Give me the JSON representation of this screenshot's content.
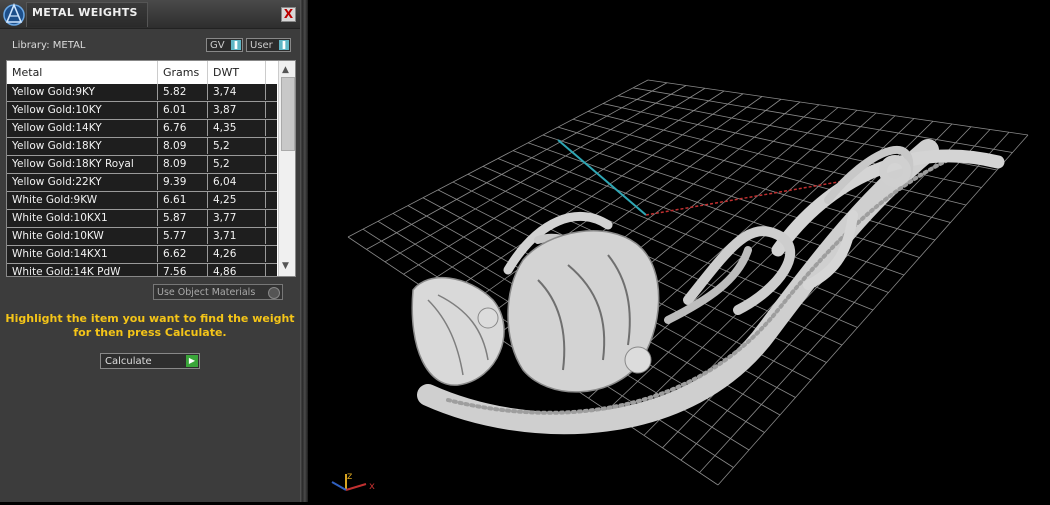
{
  "panel": {
    "title": "METAL WEIGHTS",
    "close_label": "X",
    "library_label": "Library: METAL",
    "gv_label": "GV",
    "user_label": "User",
    "use_object_materials": "Use Object Materials",
    "instruction_line1": "Highlight the item you want to find the weight",
    "instruction_line2": "for then press Calculate.",
    "calculate_label": "Calculate"
  },
  "table": {
    "columns": [
      "Metal",
      "Grams",
      "DWT"
    ],
    "rows": [
      {
        "metal": "Yellow Gold:9KY",
        "grams": "5.82",
        "dwt": "3,74"
      },
      {
        "metal": "Yellow Gold:10KY",
        "grams": "6.01",
        "dwt": "3,87"
      },
      {
        "metal": "Yellow Gold:14KY",
        "grams": "6.76",
        "dwt": "4,35"
      },
      {
        "metal": "Yellow Gold:18KY",
        "grams": "8.09",
        "dwt": "5,2"
      },
      {
        "metal": "Yellow Gold:18KY Royal",
        "grams": "8.09",
        "dwt": "5,2"
      },
      {
        "metal": "Yellow Gold:22KY",
        "grams": "9.39",
        "dwt": "6,04"
      },
      {
        "metal": "White Gold:9KW",
        "grams": "6.61",
        "dwt": "4,25"
      },
      {
        "metal": "White Gold:10KX1",
        "grams": "5.87",
        "dwt": "3,77"
      },
      {
        "metal": "White Gold:10KW",
        "grams": "5.77",
        "dwt": "3,71"
      },
      {
        "metal": "White Gold:14KX1",
        "grams": "6.62",
        "dwt": "4,26"
      },
      {
        "metal": "White Gold:14K PdW",
        "grams": "7.56",
        "dwt": "4,86"
      }
    ]
  },
  "viewport": {
    "axis_z": "z",
    "axis_x": "x",
    "grid_color": "#8a8a8a",
    "x_axis_color": "#c03030",
    "y_axis_color": "#2fa7b5",
    "model_color": "#d8d8d8"
  }
}
